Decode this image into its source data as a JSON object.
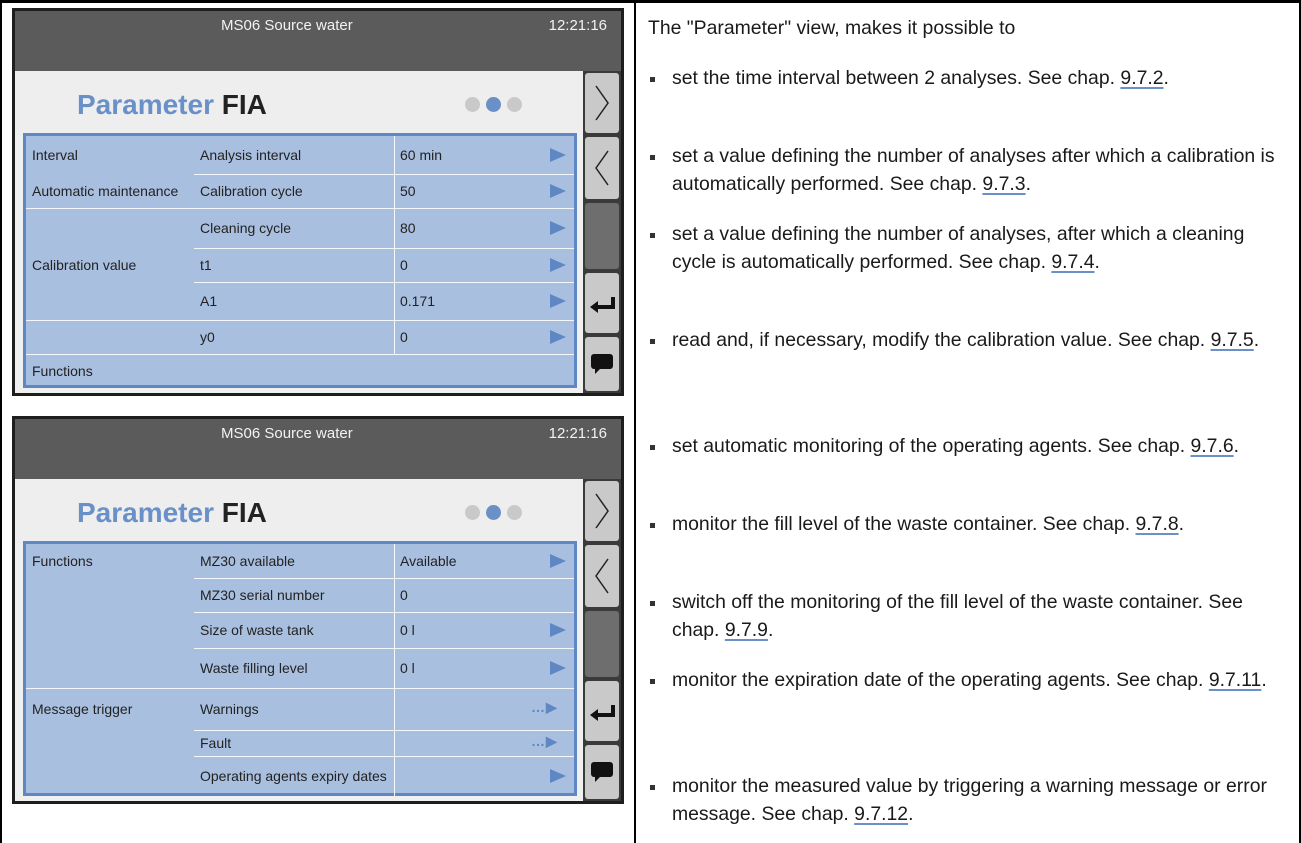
{
  "screen1": {
    "header": {
      "name": "MS06 Source water",
      "time": "12:21:16"
    },
    "title_part1": "Parameter",
    "title_part2": "FIA",
    "active_page_dot": 2,
    "rows": [
      {
        "group": "Interval",
        "label": "Analysis interval",
        "value": "60 min",
        "arrow": "arrow"
      },
      {
        "group": "Automatic maintenance",
        "label": "Calibration cycle",
        "value": "50",
        "arrow": "arrow"
      },
      {
        "group": "",
        "label": "Cleaning cycle",
        "value": "80",
        "arrow": "arrow"
      },
      {
        "group": "Calibration value",
        "label": "t1",
        "value": "0",
        "arrow": "arrow"
      },
      {
        "group": "",
        "label": "A1",
        "value": "0.171",
        "arrow": "arrow"
      },
      {
        "group": "",
        "label": "y0",
        "value": "0",
        "arrow": "arrow"
      },
      {
        "group": "Functions",
        "label": "",
        "value": "",
        "arrow": "none"
      }
    ]
  },
  "screen2": {
    "header": {
      "name": "MS06 Source water",
      "time": "12:21:16"
    },
    "title_part1": "Parameter",
    "title_part2": "FIA",
    "active_page_dot": 2,
    "rows": [
      {
        "group": "Functions",
        "label": "MZ30 available",
        "value": "Available",
        "arrow": "arrow"
      },
      {
        "group": "",
        "label": "MZ30 serial number",
        "value": "0",
        "arrow": "none"
      },
      {
        "group": "",
        "label": "Size of waste tank",
        "value": "0 l",
        "arrow": "arrow"
      },
      {
        "group": "",
        "label": "Waste filling level",
        "value": "0 l",
        "arrow": "arrow"
      },
      {
        "group": "Message trigger",
        "label": "Warnings",
        "value": "",
        "arrow": "ellipsis"
      },
      {
        "group": "",
        "label": "Fault",
        "value": "",
        "arrow": "ellipsis"
      },
      {
        "group": "",
        "label": "Operating agents expiry dates",
        "value": "",
        "arrow": "arrow"
      }
    ]
  },
  "sidebar_icons": [
    "chevron-right-icon",
    "chevron-left-icon",
    "scrollbar",
    "back-arrow-icon",
    "message-icon"
  ],
  "text": {
    "intro": "The \"Parameter\" view, makes it possible to",
    "bullets": [
      {
        "pre": "set the time interval between 2 analyses. See chap. ",
        "link": "9.7.2",
        "post": "."
      },
      {
        "pre": "set a value defining the number of analyses after which a calibration is automatically performed. See chap. ",
        "link": "9.7.3",
        "post": "."
      },
      {
        "pre": "set a value defining the number of analyses, after which a cleaning cycle is automatically performed. See chap. ",
        "link": "9.7.4",
        "post": "."
      },
      {
        "pre": "read and, if necessary, modify the calibration value. See chap. ",
        "link": "9.7.5",
        "post": "."
      },
      {
        "pre": "set automatic monitoring of the operating agents. See chap. ",
        "link": "9.7.6",
        "post": "."
      },
      {
        "pre": "monitor the fill level of the waste container. See chap. ",
        "link": "9.7.8",
        "post": "."
      },
      {
        "pre": "switch off the monitoring of the fill level of the waste container. See chap. ",
        "link": "9.7.9",
        "post": "."
      },
      {
        "pre": "monitor the expiration date of the operating agents. See chap. ",
        "link": "9.7.11",
        "post": "."
      },
      {
        "pre": "monitor the measured value by triggering a warning message or error message. See chap. ",
        "link": "9.7.12",
        "post": "."
      }
    ]
  },
  "colors": {
    "accent": "#6a90c8",
    "table_bg": "#a9bfdf",
    "header_bg": "#5b5b5b"
  }
}
